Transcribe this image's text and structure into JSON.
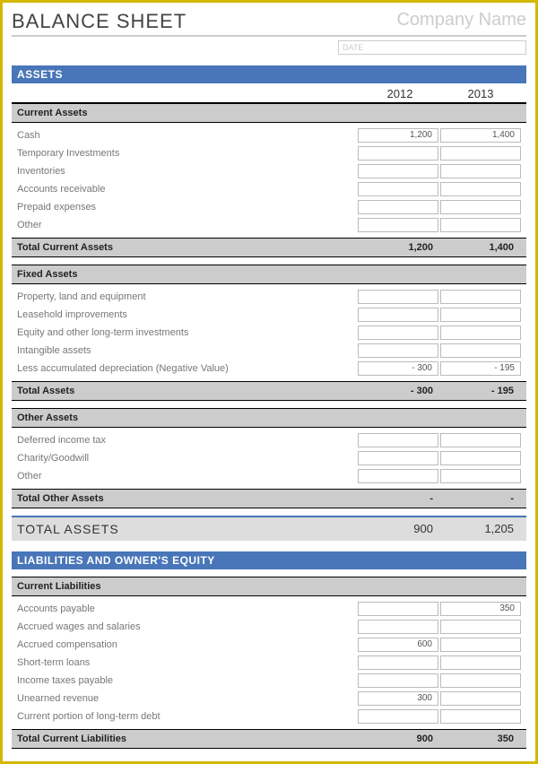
{
  "header": {
    "title": "BALANCE SHEET",
    "company_placeholder": "Company Name",
    "date_placeholder": "DATE"
  },
  "years": {
    "y1": "2012",
    "y2": "2013"
  },
  "assets": {
    "section_title": "ASSETS",
    "current": {
      "header": "Current Assets",
      "rows": {
        "cash": {
          "label": "Cash",
          "v1": "1,200",
          "v2": "1,400"
        },
        "temp_inv": {
          "label": "Temporary Investments",
          "v1": "",
          "v2": ""
        },
        "inventories": {
          "label": "Inventories",
          "v1": "",
          "v2": ""
        },
        "ar": {
          "label": "Accounts receivable",
          "v1": "",
          "v2": ""
        },
        "prepaid": {
          "label": "Prepaid expenses",
          "v1": "",
          "v2": ""
        },
        "other": {
          "label": "Other",
          "v1": "",
          "v2": ""
        }
      },
      "total": {
        "label": "Total Current Assets",
        "v1": "1,200",
        "v2": "1,400"
      }
    },
    "fixed": {
      "header": "Fixed Assets",
      "rows": {
        "property": {
          "label": "Property, land and equipment",
          "v1": "",
          "v2": ""
        },
        "leasehold": {
          "label": "Leasehold improvements",
          "v1": "",
          "v2": ""
        },
        "equity_lt": {
          "label": "Equity and other long-term investments",
          "v1": "",
          "v2": ""
        },
        "intangible": {
          "label": "Intangible assets",
          "v1": "",
          "v2": ""
        },
        "less_dep": {
          "label": "Less accumulated depreciation (Negative Value)",
          "v1": "- 300",
          "v2": "- 195"
        }
      },
      "total": {
        "label": "Total Assets",
        "v1": "- 300",
        "v2": "- 195"
      }
    },
    "other": {
      "header": "Other Assets",
      "rows": {
        "deferred": {
          "label": "Deferred income tax",
          "v1": "",
          "v2": ""
        },
        "charity": {
          "label": "Charity/Goodwill",
          "v1": "",
          "v2": ""
        },
        "other": {
          "label": "Other",
          "v1": "",
          "v2": ""
        }
      },
      "total": {
        "label": "Total Other Assets",
        "v1": "-",
        "v2": "-"
      }
    },
    "grand": {
      "label": "TOTAL ASSETS",
      "v1": "900",
      "v2": "1,205"
    }
  },
  "liabilities": {
    "section_title": "LIABILITIES AND OWNER'S EQUITY",
    "current": {
      "header": "Current Liabilities",
      "rows": {
        "ap": {
          "label": "Accounts payable",
          "v1": "",
          "v2": "350"
        },
        "wages": {
          "label": "Accrued wages and salaries",
          "v1": "",
          "v2": ""
        },
        "comp": {
          "label": "Accrued compensation",
          "v1": "600",
          "v2": ""
        },
        "loans": {
          "label": "Short-term loans",
          "v1": "",
          "v2": ""
        },
        "taxes": {
          "label": "Income taxes payable",
          "v1": "",
          "v2": ""
        },
        "unearned": {
          "label": "Unearned revenue",
          "v1": "300",
          "v2": ""
        },
        "ltdebt": {
          "label": "Current portion of long-term debt",
          "v1": "",
          "v2": ""
        }
      },
      "total": {
        "label": "Total Current Liabilities",
        "v1": "900",
        "v2": "350"
      }
    }
  }
}
